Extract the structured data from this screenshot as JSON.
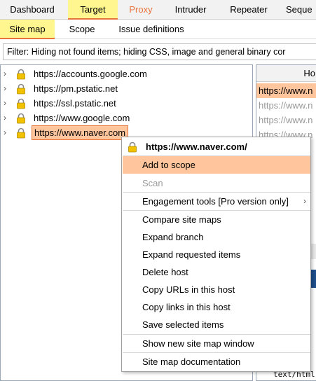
{
  "top_tabs": [
    "Dashboard",
    "Target",
    "Proxy",
    "Intruder",
    "Repeater",
    "Seque"
  ],
  "sub_tabs": [
    "Site map",
    "Scope",
    "Issue definitions"
  ],
  "filter_text": "Filter: Hiding not found items;  hiding CSS, image and general binary cor",
  "tree": {
    "hosts": [
      "https://accounts.google.com",
      "https://pm.pstatic.net",
      "https://ssl.pstatic.net",
      "https://www.google.com",
      "https://www.naver.com"
    ]
  },
  "right_panel": {
    "header": "Ho",
    "rows": [
      "https://www.n",
      "https://www.n",
      "https://www.n",
      "https://www.n"
    ],
    "bottom_text": "text/html"
  },
  "context_menu": {
    "header": "https://www.naver.com/",
    "items": {
      "add_to_scope": "Add to scope",
      "scan": "Scan",
      "engagement_tools": "Engagement tools [Pro version only]",
      "compare_site_maps": "Compare site maps",
      "expand_branch": "Expand branch",
      "expand_requested_items": "Expand requested items",
      "delete_host": "Delete host",
      "copy_urls": "Copy URLs in this host",
      "copy_links": "Copy links in this host",
      "save_selected_items": "Save selected items",
      "show_new_window": "Show new site map window",
      "documentation": "Site map documentation"
    }
  },
  "colors": {
    "active_tab_bg": "#fff68f",
    "accent_orange": "#e8743b",
    "selection_bg": "#ffc59d"
  },
  "icons": {
    "host_icon": "lock-icon",
    "expand_icon": "chevron-right-icon",
    "submenu_icon": "chevron-right-icon"
  }
}
